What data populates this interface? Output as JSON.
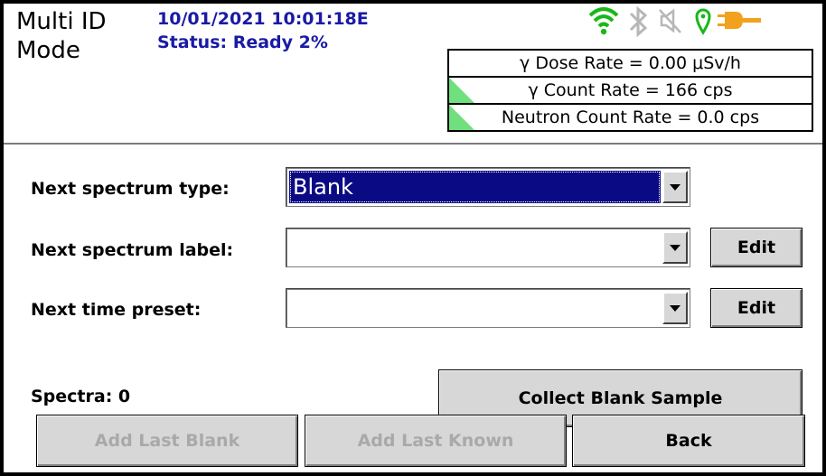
{
  "header": {
    "mode_title": "Multi ID Mode",
    "datetime": "10/01/2021 10:01:18E",
    "status": "Status: Ready 2%"
  },
  "status_icons": [
    "wifi-icon",
    "bluetooth-icon",
    "speaker-muted-icon",
    "location-pin-icon",
    "power-plug-icon"
  ],
  "colors": {
    "header_text": "#1a1aa6",
    "wifi": "#18b818",
    "rate_indicator": "#6fe07d",
    "selection": "#0a0a84",
    "plug": "#f2a11e"
  },
  "rates": [
    "γ Dose Rate = 0.00  μSv/h",
    "γ Count Rate = 166 cps",
    "Neutron Count Rate = 0.0 cps"
  ],
  "form": {
    "spectrum_type_label": "Next spectrum type:",
    "spectrum_type_value": "Blank",
    "spectrum_label_label": "Next spectrum label:",
    "spectrum_label_value": "",
    "time_preset_label": "Next time preset:",
    "time_preset_value": "",
    "edit_label": "Edit",
    "spectra_count": "Spectra: 0"
  },
  "buttons": {
    "collect_blank": "Collect Blank Sample",
    "add_last_blank": "Add Last Blank",
    "add_last_known": "Add Last Known",
    "back": "Back"
  }
}
